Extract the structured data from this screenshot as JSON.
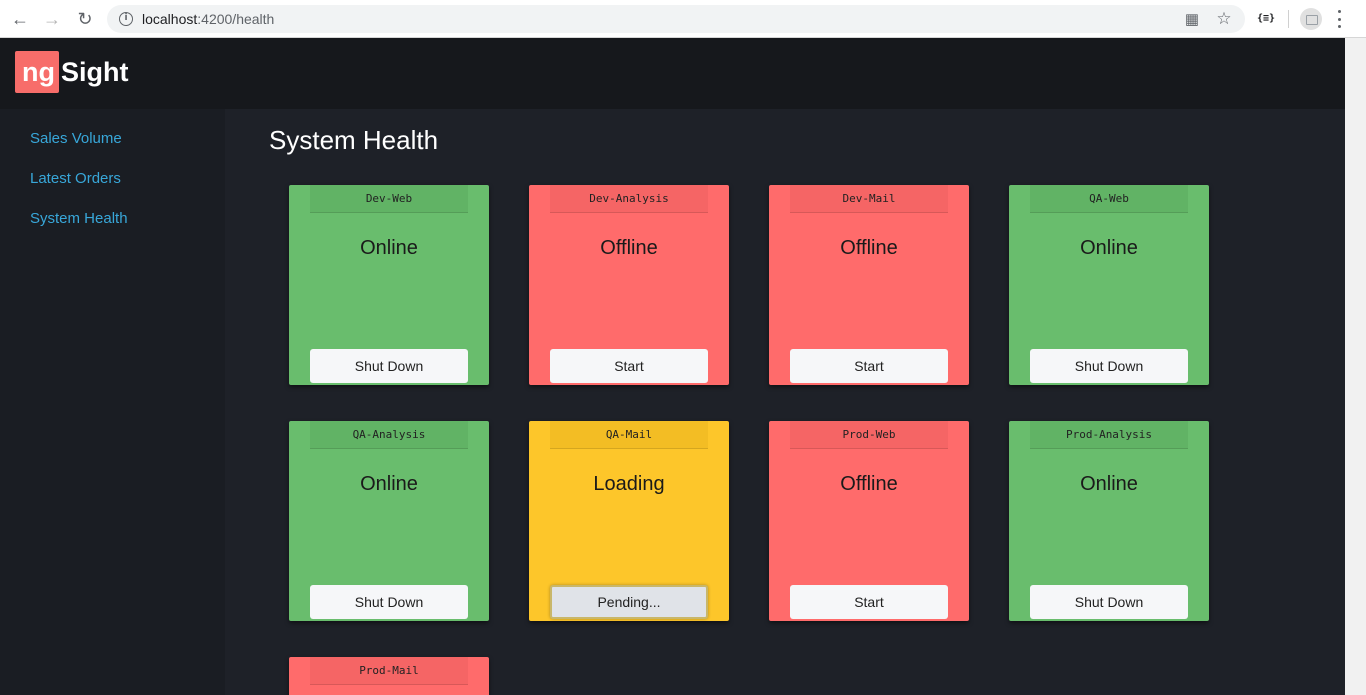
{
  "browser": {
    "url_host": "localhost",
    "url_path": ":4200/health"
  },
  "app": {
    "logo_ng": "ng",
    "logo_sight": "Sight"
  },
  "sidebar": {
    "items": [
      {
        "label": "Sales Volume"
      },
      {
        "label": "Latest Orders"
      },
      {
        "label": "System Health"
      }
    ]
  },
  "page": {
    "title": "System Health"
  },
  "servers": [
    {
      "name": "Dev-Web",
      "status": "Online",
      "action": "Shut Down",
      "state": "online"
    },
    {
      "name": "Dev-Analysis",
      "status": "Offline",
      "action": "Start",
      "state": "offline"
    },
    {
      "name": "Dev-Mail",
      "status": "Offline",
      "action": "Start",
      "state": "offline"
    },
    {
      "name": "QA-Web",
      "status": "Online",
      "action": "Shut Down",
      "state": "online"
    },
    {
      "name": "QA-Analysis",
      "status": "Online",
      "action": "Shut Down",
      "state": "online"
    },
    {
      "name": "QA-Mail",
      "status": "Loading",
      "action": "Pending...",
      "state": "loading"
    },
    {
      "name": "Prod-Web",
      "status": "Offline",
      "action": "Start",
      "state": "offline"
    },
    {
      "name": "Prod-Analysis",
      "status": "Online",
      "action": "Shut Down",
      "state": "online"
    },
    {
      "name": "Prod-Mail",
      "status": "",
      "action": "",
      "state": "offline"
    }
  ],
  "colors": {
    "online": "#69bd6d",
    "offline": "#ff6b6b",
    "loading": "#fdc62a",
    "link": "#38a7d9"
  }
}
